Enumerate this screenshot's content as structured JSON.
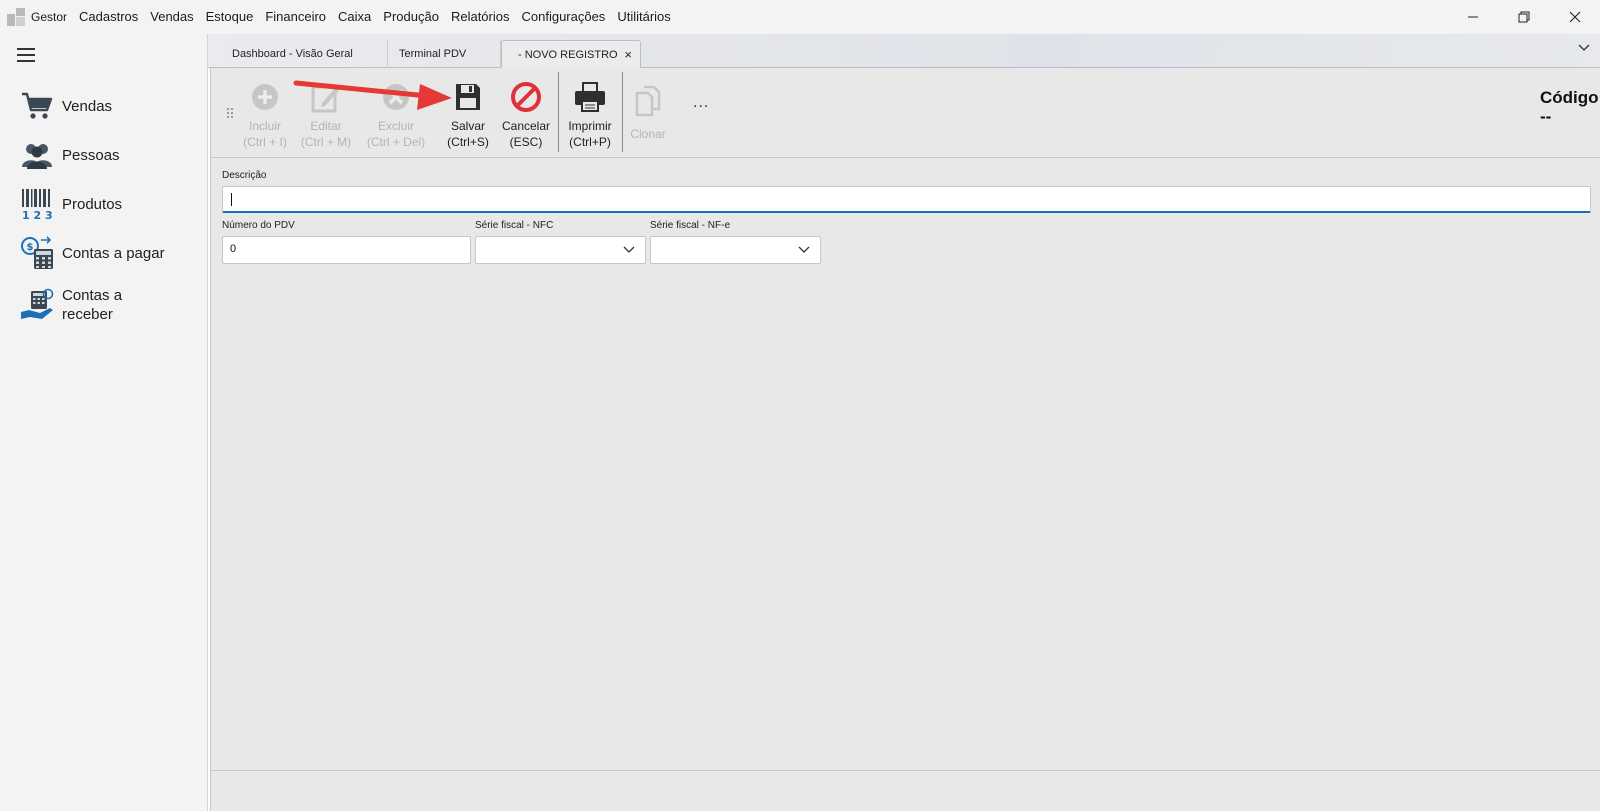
{
  "menu": {
    "items": [
      "Gestor",
      "Cadastros",
      "Vendas",
      "Estoque",
      "Financeiro",
      "Caixa",
      "Produção",
      "Relatórios",
      "Configurações",
      "Utilitários"
    ]
  },
  "sidebar": {
    "items": [
      {
        "label": "Vendas",
        "icon": "cart-icon"
      },
      {
        "label": "Pessoas",
        "icon": "people-icon"
      },
      {
        "label": "Produtos",
        "icon": "barcode-icon"
      },
      {
        "label": "Contas a pagar",
        "icon": "calculator-money-icon"
      },
      {
        "label": "Contas a receber",
        "icon": "hand-money-icon"
      }
    ]
  },
  "tabs": [
    {
      "label": "Dashboard - Visão Geral"
    },
    {
      "label": "Terminal PDV"
    },
    {
      "label": "- NOVO REGISTRO",
      "active": true,
      "close": "×"
    }
  ],
  "toolbar": {
    "buttons": [
      {
        "line1": "Incluir",
        "line2": "(Ctrl + I)",
        "enabled": false
      },
      {
        "line1": "Editar",
        "line2": "(Ctrl + M)",
        "enabled": false
      },
      {
        "line1": "Excluir",
        "line2": "(Ctrl + Del)",
        "enabled": false
      },
      {
        "line1": "Salvar",
        "line2": "(Ctrl+S)",
        "enabled": true
      },
      {
        "line1": "Cancelar",
        "line2": "(ESC)",
        "enabled": true
      },
      {
        "line1": "Imprimir",
        "line2": "(Ctrl+P)",
        "enabled": true
      },
      {
        "line1": "Clonar",
        "line2": "",
        "enabled": false
      }
    ],
    "more": "...",
    "codigo_label": "Código",
    "codigo_value": "--"
  },
  "form": {
    "descricao": {
      "label": "Descrição",
      "value": ""
    },
    "numero_pdv": {
      "label": "Número do PDV",
      "value": "0"
    },
    "serie_nfc": {
      "label": "Série fiscal - NFC",
      "value": ""
    },
    "serie_nfe": {
      "label": "Série fiscal - NF-e",
      "value": ""
    }
  },
  "colors": {
    "accent_focus": "#1c6dbd",
    "cancel_red": "#e0303a",
    "arrow_red": "#e53935",
    "sidebar_icon_blue": "#1f6fb5"
  }
}
